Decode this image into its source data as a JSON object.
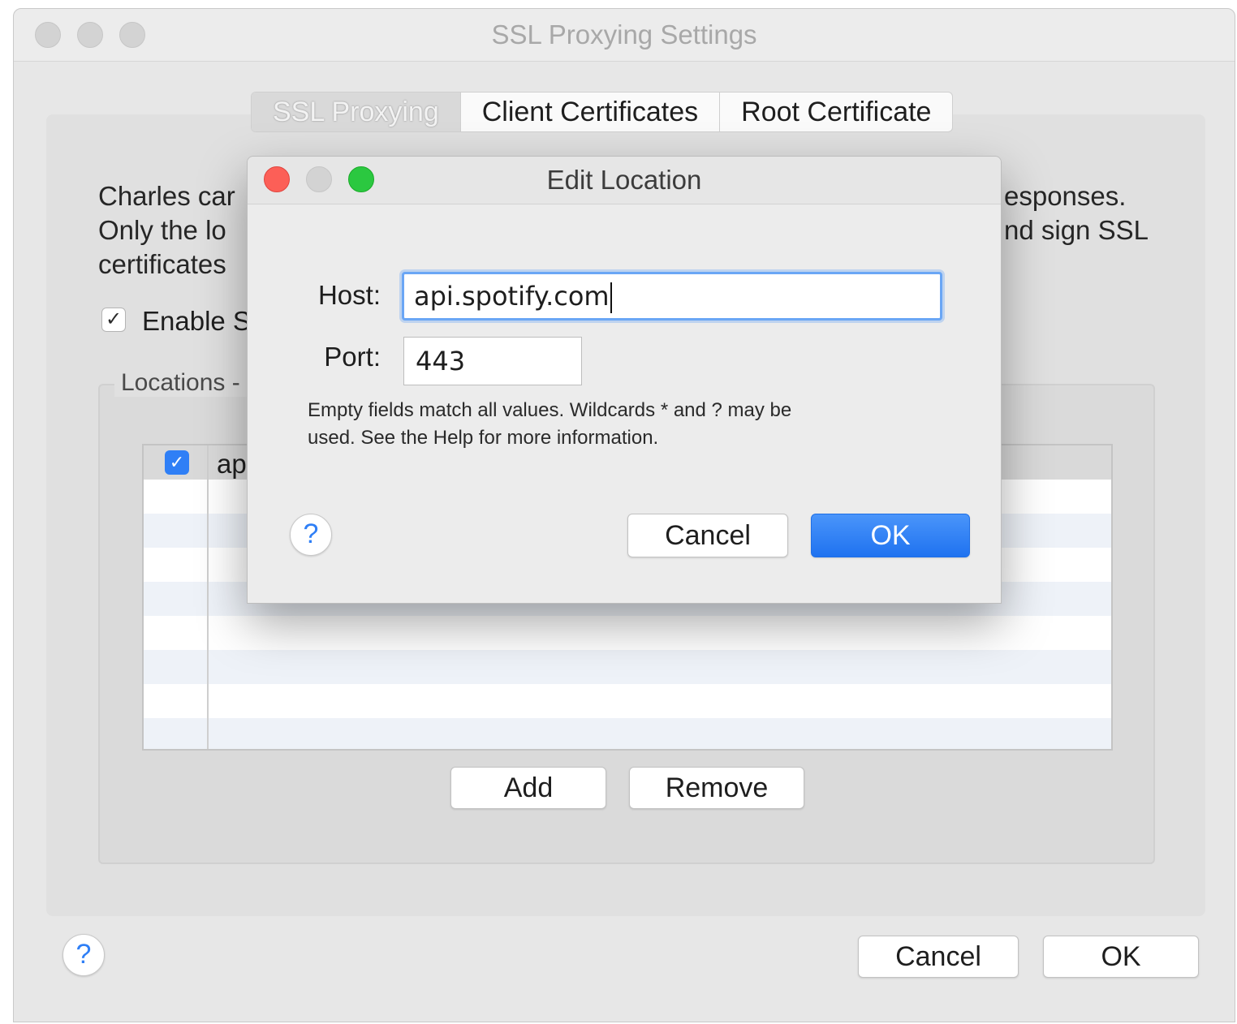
{
  "main_window": {
    "title": "SSL Proxying Settings",
    "tabs": [
      {
        "label": "SSL Proxying"
      },
      {
        "label": "Client Certificates"
      },
      {
        "label": "Root Certificate"
      }
    ],
    "description_left": [
      "Charles car",
      "Only the lo",
      "certificates"
    ],
    "description_right": [
      "esponses.",
      "nd sign SSL"
    ],
    "enable_checkbox": {
      "checked": true,
      "mark": "✓",
      "label": "Enable S"
    },
    "locations": {
      "legend": "Locations -",
      "rows": [
        {
          "checked": true,
          "mark": "✓",
          "text": "ap"
        }
      ]
    },
    "add_label": "Add",
    "remove_label": "Remove",
    "help_label": "?",
    "cancel_label": "Cancel",
    "ok_label": "OK"
  },
  "dialog": {
    "title": "Edit Location",
    "host_label": "Host:",
    "host_value": "api.spotify.com",
    "port_label": "Port:",
    "port_value": "443",
    "hint_lines": [
      "Empty fields match all values. Wildcards * and ? may be",
      "used. See the Help for more information."
    ],
    "help_label": "?",
    "cancel_label": "Cancel",
    "ok_label": "OK"
  },
  "colors": {
    "accent_blue": "#2f7ff6",
    "traffic_red": "#fc5f57",
    "traffic_yellow_inactive": "#d0d0d0",
    "traffic_green": "#2bc840"
  }
}
